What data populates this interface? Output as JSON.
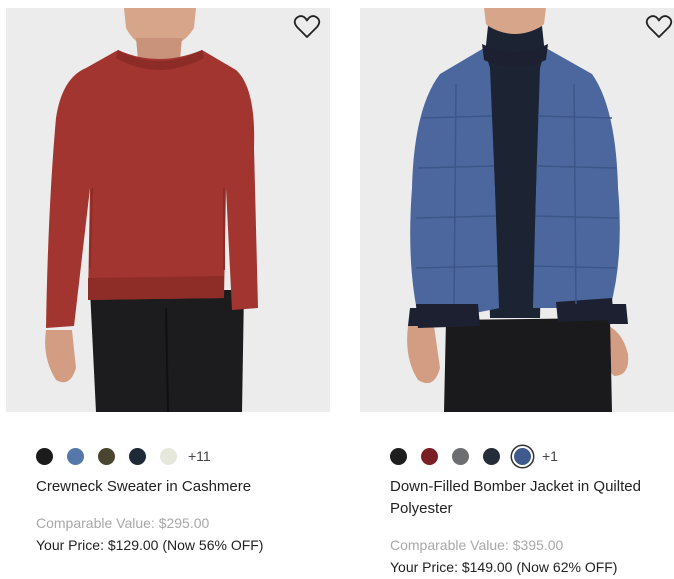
{
  "products": [
    {
      "title": "Crewneck Sweater in Cashmere",
      "image_alt": "model wearing red crewneck sweater",
      "wishlist_icon": "heart-outline-icon",
      "swatches": [
        {
          "color": "#1b1b1b",
          "selected": false
        },
        {
          "color": "#5577a9",
          "selected": false
        },
        {
          "color": "#4a4530",
          "selected": false
        },
        {
          "color": "#1f2a38",
          "selected": false
        },
        {
          "color": "#e6e8dc",
          "selected": false
        }
      ],
      "more_colors": "+11",
      "comparable_value": "Comparable Value: $295.00",
      "your_price": "Your Price: $129.00 (Now 56% OFF)"
    },
    {
      "title": "Down-Filled Bomber Jacket in Quilted Polyester",
      "image_alt": "model wearing blue quilted bomber jacket",
      "wishlist_icon": "heart-outline-icon",
      "swatches": [
        {
          "color": "#1e1e1e",
          "selected": false
        },
        {
          "color": "#7a1f26",
          "selected": false
        },
        {
          "color": "#6d6e72",
          "selected": false
        },
        {
          "color": "#262d3a",
          "selected": false
        },
        {
          "color": "#3f5a8c",
          "selected": true
        }
      ],
      "more_colors": "+1",
      "comparable_value": "Comparable Value: $395.00",
      "your_price": "Your Price: $149.00 (Now 62% OFF)"
    }
  ]
}
